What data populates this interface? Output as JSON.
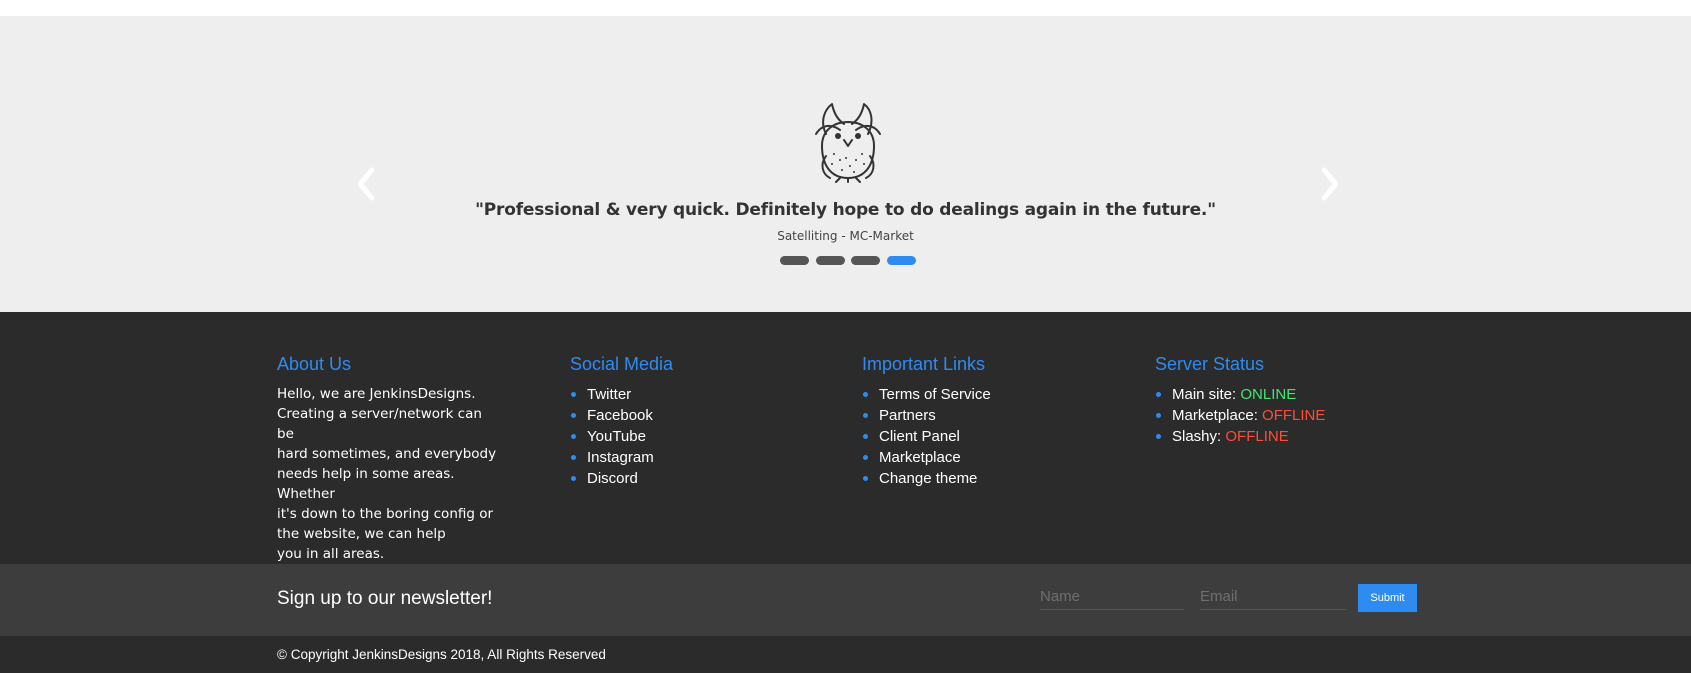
{
  "testimonial": {
    "quote": "\"Professional & very quick. Definitely hope to do dealings again in the future.\"",
    "author": "Satelliting - MC-Market",
    "slide_count": 4,
    "active_slide": 4
  },
  "icons": {
    "prev": "chevron-left-icon",
    "next": "chevron-right-icon",
    "mascot": "owl-mascot-icon"
  },
  "footer": {
    "about": {
      "title": "About Us",
      "text_lines": [
        "Hello, we are JenkinsDesigns.",
        "Creating a server/network can be",
        "hard sometimes, and everybody",
        "needs help in some areas. Whether",
        "it's down to the boring config or",
        "the website, we can help",
        "you in all areas."
      ]
    },
    "social": {
      "title": "Social Media",
      "items": [
        "Twitter",
        "Facebook",
        "YouTube",
        "Instagram",
        "Discord"
      ]
    },
    "links": {
      "title": "Important Links",
      "items": [
        "Terms of Service",
        "Partners",
        "Client Panel",
        "Marketplace",
        "Change theme"
      ]
    },
    "status": {
      "title": "Server Status",
      "items": [
        {
          "label": "Main site:",
          "value": "ONLINE"
        },
        {
          "label": "Marketplace:",
          "value": "OFFLINE"
        },
        {
          "label": "Slashy:",
          "value": "OFFLINE"
        }
      ]
    }
  },
  "newsletter": {
    "title": "Sign up to our newsletter!",
    "name_placeholder": "Name",
    "email_placeholder": "Email",
    "submit_label": "Submit"
  },
  "copyright": "© Copyright JenkinsDesigns 2018, All Rights Reserved",
  "colors": {
    "accent": "#2e8cf0",
    "online": "#3ee870",
    "offline": "#ff4d3a"
  }
}
